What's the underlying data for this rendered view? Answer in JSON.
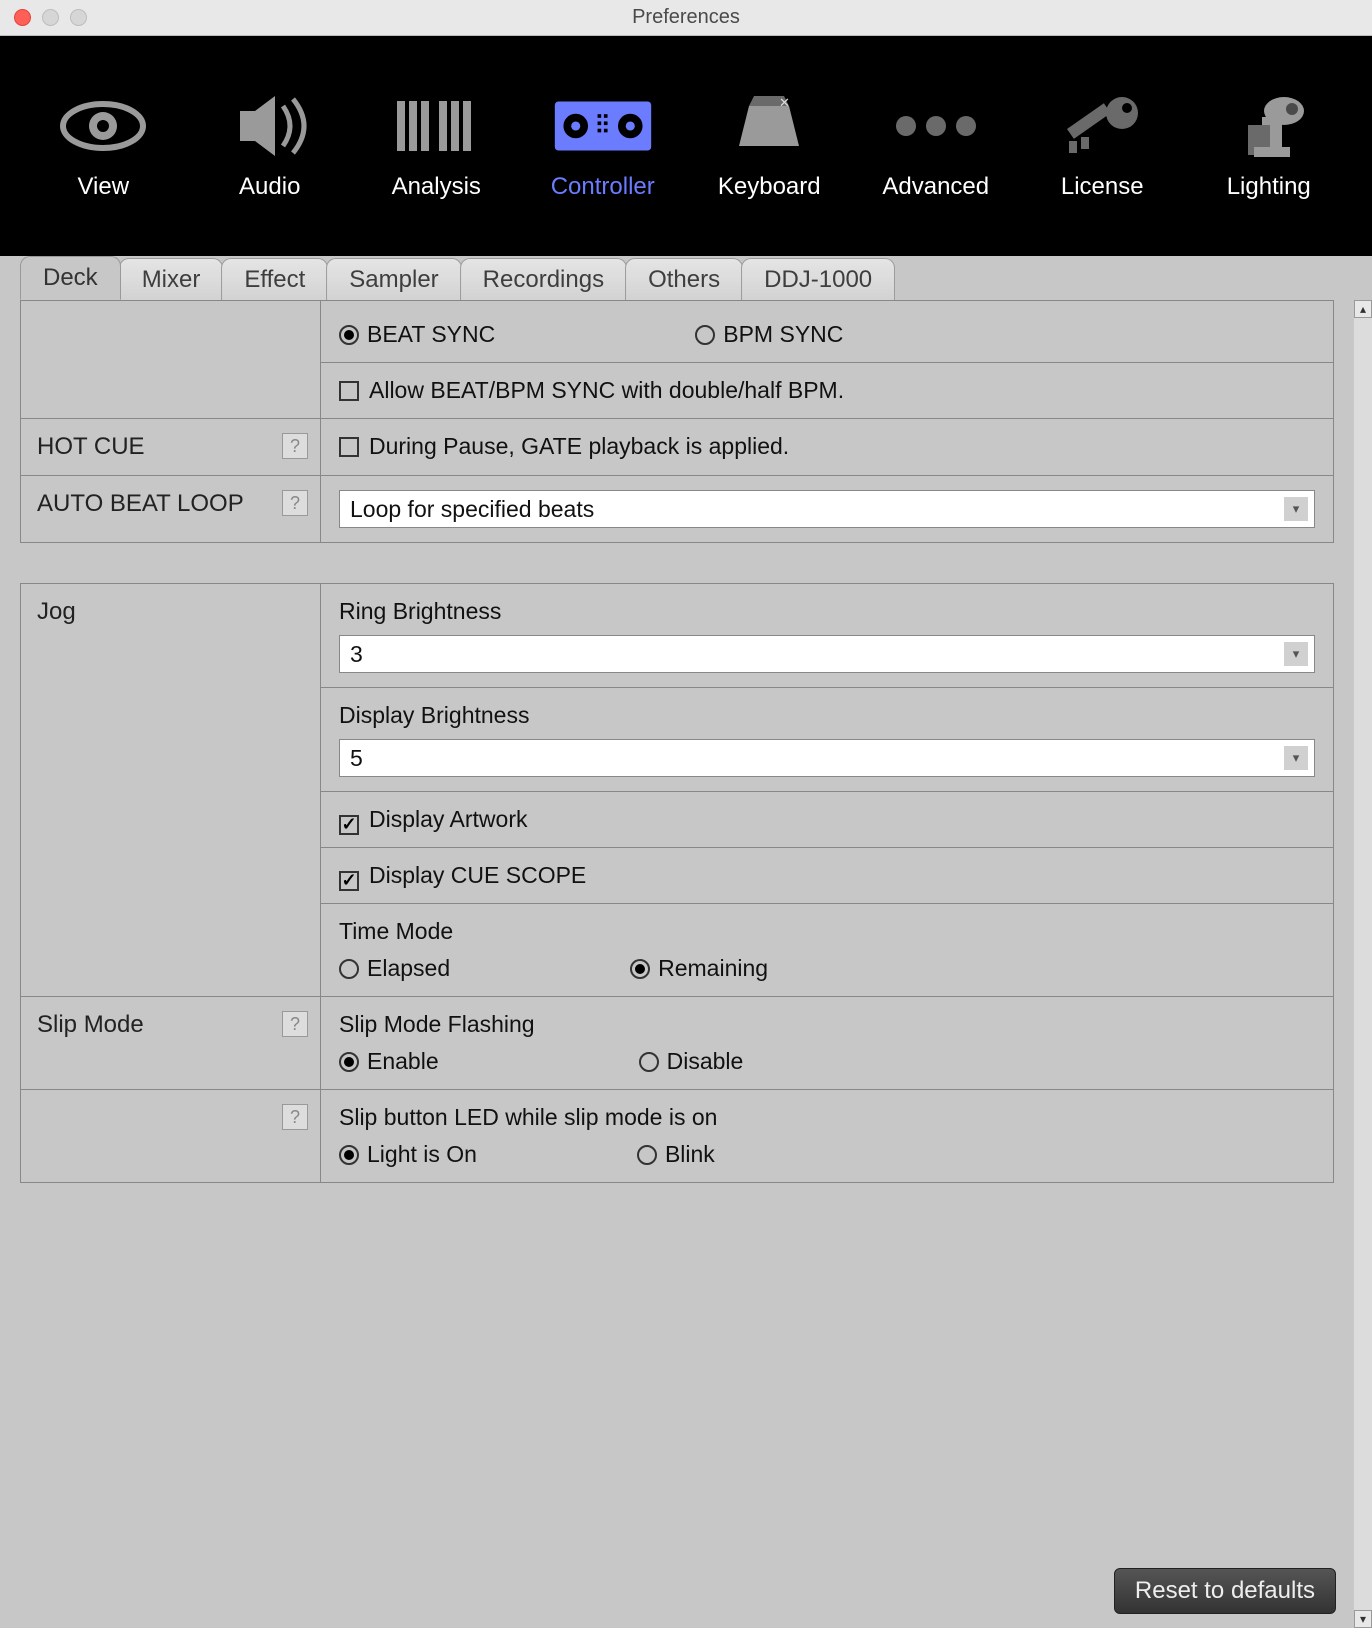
{
  "window": {
    "title": "Preferences"
  },
  "toolbar": {
    "items": [
      {
        "label": "View"
      },
      {
        "label": "Audio"
      },
      {
        "label": "Analysis"
      },
      {
        "label": "Controller",
        "active": true
      },
      {
        "label": "Keyboard"
      },
      {
        "label": "Advanced"
      },
      {
        "label": "License"
      },
      {
        "label": "Lighting"
      }
    ]
  },
  "tabs": [
    {
      "label": "Deck",
      "active": true
    },
    {
      "label": "Mixer"
    },
    {
      "label": "Effect"
    },
    {
      "label": "Sampler"
    },
    {
      "label": "Recordings"
    },
    {
      "label": "Others"
    },
    {
      "label": "DDJ-1000"
    }
  ],
  "sync": {
    "beat_sync": "BEAT SYNC",
    "bpm_sync": "BPM SYNC",
    "beat_selected": true,
    "allow_half_double_label": "Allow BEAT/BPM SYNC with double/half BPM.",
    "allow_half_double_checked": false
  },
  "hotcue": {
    "label": "HOT CUE",
    "gate_label": "During Pause, GATE playback is applied.",
    "gate_checked": false
  },
  "auto_beat_loop": {
    "label": "AUTO BEAT LOOP",
    "value": "Loop for specified beats"
  },
  "jog": {
    "label": "Jog",
    "ring_brightness_label": "Ring Brightness",
    "ring_brightness_value": "3",
    "display_brightness_label": "Display Brightness",
    "display_brightness_value": "5",
    "display_artwork_label": "Display Artwork",
    "display_artwork_checked": true,
    "display_cue_scope_label": "Display CUE SCOPE",
    "display_cue_scope_checked": true,
    "time_mode_label": "Time Mode",
    "time_elapsed": "Elapsed",
    "time_remaining": "Remaining",
    "time_selected": "remaining"
  },
  "slip": {
    "label": "Slip Mode",
    "flashing_label": "Slip Mode Flashing",
    "flashing_enable": "Enable",
    "flashing_disable": "Disable",
    "flashing_selected": "enable",
    "led_label": "Slip button LED while slip mode is on",
    "led_light_on": "Light is On",
    "led_blink": "Blink",
    "led_selected": "light_on"
  },
  "footer": {
    "reset_label": "Reset to defaults"
  }
}
